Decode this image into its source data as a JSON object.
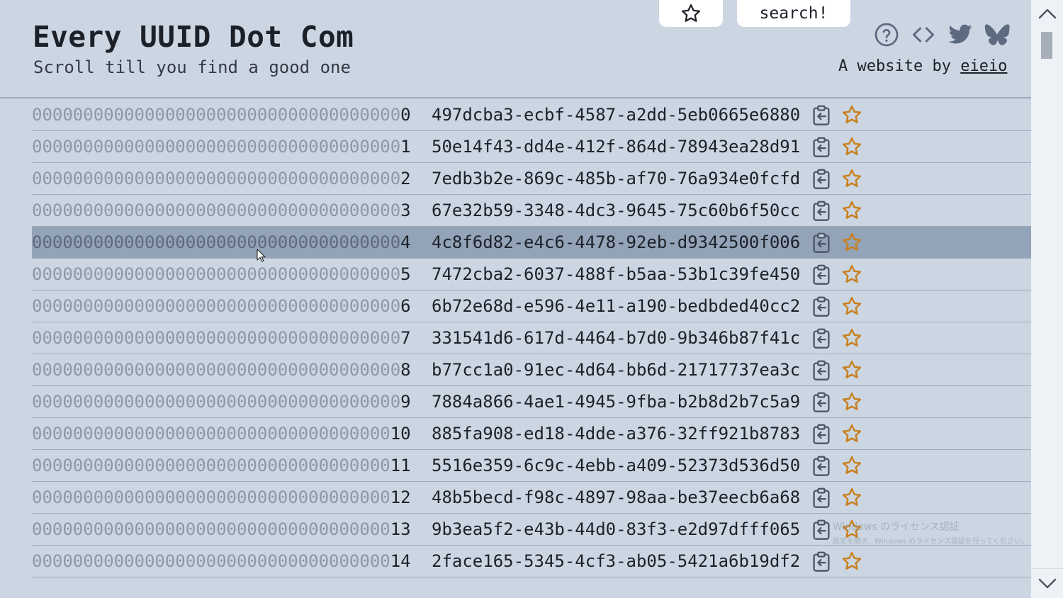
{
  "header": {
    "title": "Every UUID Dot Com",
    "subtitle": "Scroll till you find a good one",
    "search_label": "search!",
    "byline_prefix": "A website by",
    "byline_link": "eieio",
    "icons": [
      "help-icon",
      "code-icon",
      "twitter-icon",
      "bluesky-icon"
    ]
  },
  "colors": {
    "background": "#ccd6e2",
    "selected_row": "#93a3b8",
    "star": "#c8811e",
    "text": "#1c2129",
    "dim_text": "#8e98a5"
  },
  "list": {
    "selected_index": 4,
    "rows": [
      {
        "pad": "000000000000000000000000000000000000",
        "num": "0",
        "uuid": "497dcba3-ecbf-4587-a2dd-5eb0665e6880"
      },
      {
        "pad": "000000000000000000000000000000000000",
        "num": "1",
        "uuid": "50e14f43-dd4e-412f-864d-78943ea28d91"
      },
      {
        "pad": "000000000000000000000000000000000000",
        "num": "2",
        "uuid": "7edb3b2e-869c-485b-af70-76a934e0fcfd"
      },
      {
        "pad": "000000000000000000000000000000000000",
        "num": "3",
        "uuid": "67e32b59-3348-4dc3-9645-75c60b6f50cc"
      },
      {
        "pad": "000000000000000000000000000000000000",
        "num": "4",
        "uuid": "4c8f6d82-e4c6-4478-92eb-d9342500f006"
      },
      {
        "pad": "000000000000000000000000000000000000",
        "num": "5",
        "uuid": "7472cba2-6037-488f-b5aa-53b1c39fe450"
      },
      {
        "pad": "000000000000000000000000000000000000",
        "num": "6",
        "uuid": "6b72e68d-e596-4e11-a190-bedbded40cc2"
      },
      {
        "pad": "000000000000000000000000000000000000",
        "num": "7",
        "uuid": "331541d6-617d-4464-b7d0-9b346b87f41c"
      },
      {
        "pad": "000000000000000000000000000000000000",
        "num": "8",
        "uuid": "b77cc1a0-91ec-4d64-bb6d-21717737ea3c"
      },
      {
        "pad": "000000000000000000000000000000000000",
        "num": "9",
        "uuid": "7884a866-4ae1-4945-9fba-b2b8d2b7c5a9"
      },
      {
        "pad": "00000000000000000000000000000000000",
        "num": "10",
        "uuid": "885fa908-ed18-4dde-a376-32ff921b8783"
      },
      {
        "pad": "00000000000000000000000000000000000",
        "num": "11",
        "uuid": "5516e359-6c9c-4ebb-a409-52373d536d50"
      },
      {
        "pad": "00000000000000000000000000000000000",
        "num": "12",
        "uuid": "48b5becd-f98c-4897-98aa-be37eecb6a68"
      },
      {
        "pad": "00000000000000000000000000000000000",
        "num": "13",
        "uuid": "9b3ea5f2-e43b-44d0-83f3-e2d97dfff065"
      },
      {
        "pad": "00000000000000000000000000000000000",
        "num": "14",
        "uuid": "2face165-5345-4cf3-ab05-5421a6b19df2"
      }
    ]
  },
  "watermark": {
    "line1": "Windows のライセンス認証",
    "line2": "設定を開き、Windows のライセンス認証を行ってください。"
  }
}
